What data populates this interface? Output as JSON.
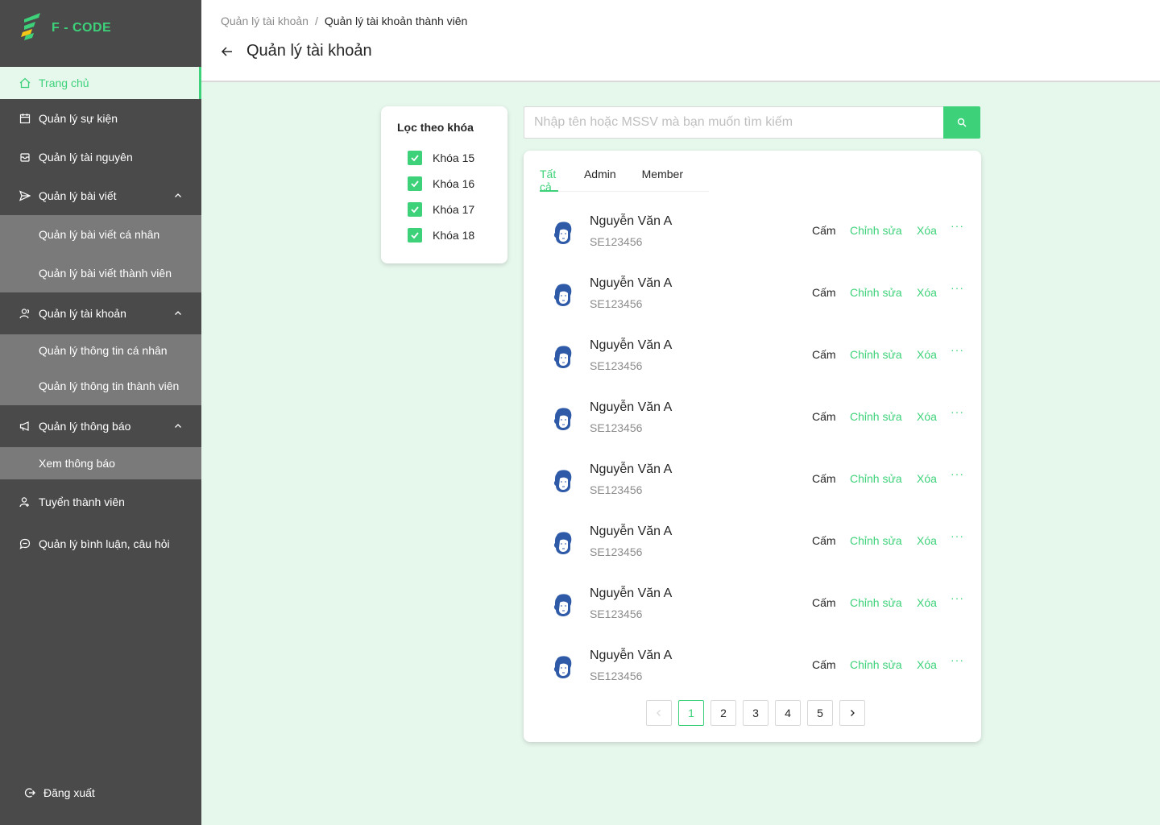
{
  "brand": {
    "name": "F - CODE"
  },
  "sidebar": {
    "items": [
      {
        "label": "Trang chủ",
        "icon": "home-icon"
      },
      {
        "label": "Quản lý sự kiện",
        "icon": "calendar-icon"
      },
      {
        "label": "Quản lý tài nguyên",
        "icon": "archive-icon"
      },
      {
        "label": "Quản lý bài viết",
        "icon": "send-icon"
      },
      {
        "label": "Quản lý bài viết cá nhân"
      },
      {
        "label": "Quản lý bài viết thành viên"
      },
      {
        "label": "Quản lý tài khoản",
        "icon": "users-icon"
      },
      {
        "label": "Quản lý thông tin cá nhân"
      },
      {
        "label": "Quản lý thông tin thành viên"
      },
      {
        "label": "Quản lý thông báo",
        "icon": "megaphone-icon"
      },
      {
        "label": "Xem thông báo"
      },
      {
        "label": "Tuyển thành viên",
        "icon": "recruit-icon"
      },
      {
        "label": "Quản lý bình luận, câu hỏi",
        "icon": "chat-icon"
      }
    ],
    "logout": "Đăng xuất"
  },
  "header": {
    "breadcrumb": [
      "Quản lý tài khoản",
      "/",
      "Quản lý tài khoản thành viên"
    ],
    "title": "Quản lý tài khoản"
  },
  "filter": {
    "title": "Lọc theo khóa",
    "options": [
      "Khóa 15",
      "Khóa 16",
      "Khóa 17",
      "Khóa 18"
    ]
  },
  "search": {
    "placeholder": "Nhập tên hoặc MSSV mà bạn muốn tìm kiếm"
  },
  "tabs": [
    "Tất cả",
    "Admin",
    "Member"
  ],
  "actions": {
    "ban": "Cấm",
    "edit": "Chỉnh sửa",
    "delete": "Xóa",
    "more": "···"
  },
  "members": [
    {
      "name": "Nguyễn Văn A",
      "mssv": "SE123456"
    },
    {
      "name": "Nguyễn Văn A",
      "mssv": "SE123456"
    },
    {
      "name": "Nguyễn Văn A",
      "mssv": "SE123456"
    },
    {
      "name": "Nguyễn Văn A",
      "mssv": "SE123456"
    },
    {
      "name": "Nguyễn Văn A",
      "mssv": "SE123456"
    },
    {
      "name": "Nguyễn Văn A",
      "mssv": "SE123456"
    },
    {
      "name": "Nguyễn Văn A",
      "mssv": "SE123456"
    },
    {
      "name": "Nguyễn Văn A",
      "mssv": "SE123456"
    }
  ],
  "pagination": {
    "pages": [
      "1",
      "2",
      "3",
      "4",
      "5"
    ],
    "current": "1"
  },
  "colors": {
    "accent": "#3dd27a",
    "sidebar": "#4a4a4a",
    "submenu": "#7a7a7a",
    "background": "#e6f7ec"
  }
}
